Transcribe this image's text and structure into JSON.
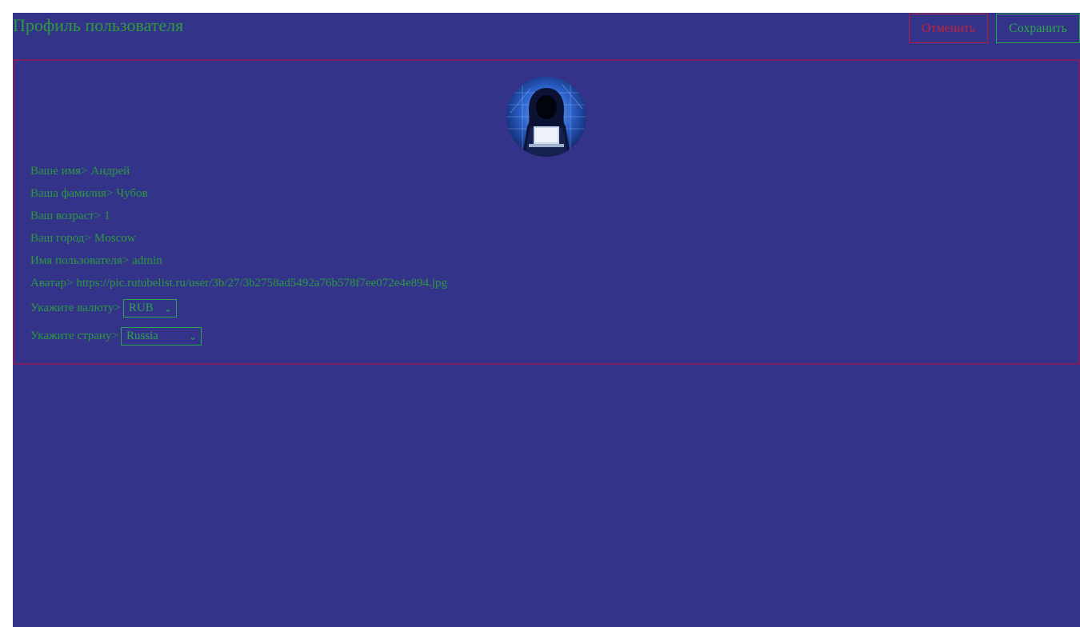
{
  "header": {
    "title": "Профиль пользователя",
    "cancel_label": "Отменить",
    "save_label": "Сохранить"
  },
  "profile": {
    "avatar_icon": "hooded-hacker-avatar",
    "separator": ">",
    "fields": {
      "first_name": {
        "label": "Ваше имя",
        "value": "Андрей"
      },
      "last_name": {
        "label": "Ваша фамилия",
        "value": "Чубов"
      },
      "age": {
        "label": "Ваш возраст",
        "value": "1"
      },
      "city": {
        "label": "Ваш город",
        "value": "Moscow"
      },
      "username": {
        "label": "Имя пользователя",
        "value": "admin"
      },
      "avatar": {
        "label": "Аватар",
        "value": "https://pic.rutubelist.ru/user/3b/27/3b2758ad5492a76b578f7ee072e4e894.jpg"
      }
    },
    "currency": {
      "label": "Укажите валюту",
      "selected": "RUB"
    },
    "country": {
      "label": "Укажите страну",
      "selected": "Russia"
    }
  },
  "colors": {
    "background": "#34338a",
    "text_green": "#2b9a3e",
    "cancel_red": "#c0243e",
    "card_border": "#7a1f62"
  }
}
